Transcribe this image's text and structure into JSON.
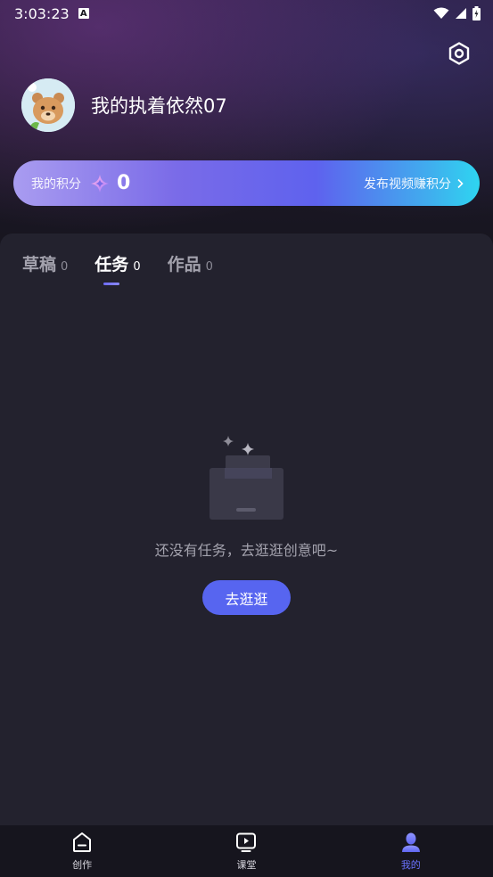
{
  "status_bar": {
    "time": "3:03:23",
    "badge": "A"
  },
  "profile": {
    "username": "我的执着依然07"
  },
  "points": {
    "label": "我的积分",
    "value": "0",
    "earn_link": "发布视频赚积分"
  },
  "tabs": [
    {
      "label": "草稿",
      "count": "0",
      "active": false
    },
    {
      "label": "任务",
      "count": "0",
      "active": true
    },
    {
      "label": "作品",
      "count": "0",
      "active": false
    }
  ],
  "empty_state": {
    "message": "还没有任务，去逛逛创意吧~",
    "button_label": "去逛逛"
  },
  "bottom_nav": [
    {
      "label": "创作",
      "icon": "create-icon",
      "active": false
    },
    {
      "label": "课堂",
      "icon": "classroom-icon",
      "active": false
    },
    {
      "label": "我的",
      "icon": "profile-icon",
      "active": true
    }
  ],
  "colors": {
    "accent": "#5765f0",
    "active_nav": "#6b73ff",
    "panel": "#23222e",
    "background": "#15141d"
  }
}
